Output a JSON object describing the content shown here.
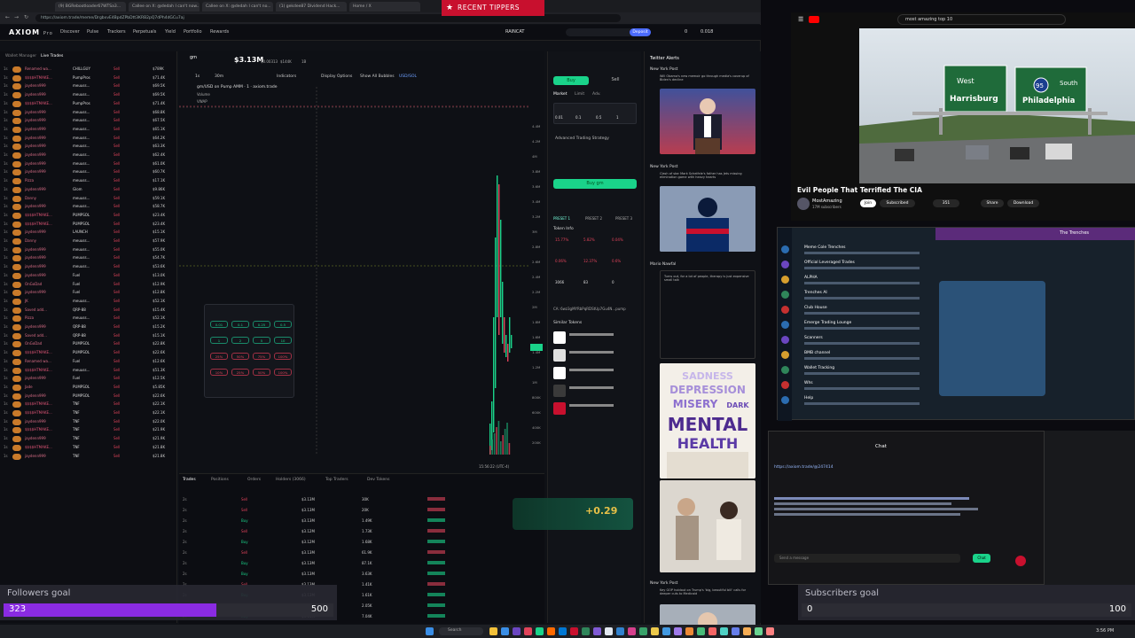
{
  "browser": {
    "tabs": [
      "(9) BGRebootloader67WTSa3...",
      "Callee on X: @dedah I can't now...",
      "Callee on X: @dedah I can't no...",
      "(1) gekdee87 Dividend Hack...",
      "Home / X"
    ],
    "url": "https://axiom.trade/meme/DrgbxvE4BpdZPbDtt3KRB2pQ7dPh4dGCu7aj"
  },
  "app": {
    "logo": "AXIOM",
    "logo_suffix": "Pro",
    "nav": [
      "Discover",
      "Pulse",
      "Trackers",
      "Perpetuals",
      "Yield",
      "Portfolio",
      "Rewards"
    ],
    "network": "RAINCAT",
    "deposit": "Deposit",
    "sol_balance": "0",
    "wallet_val": "0.018"
  },
  "leftlist": {
    "tabs": [
      "Wallet Manager",
      "Live Trades"
    ],
    "rows": [
      {
        "name": "Renamed wa...",
        "token": "CHILLGUY",
        "amt": "$789K"
      },
      {
        "name": "$$$$HTMAKE...",
        "token": "PumpPros",
        "amt": "$71.4K"
      },
      {
        "name": "jaydenn999",
        "token": "meuuss...",
        "amt": "$69.5K"
      },
      {
        "name": "jaydenn999",
        "token": "meuuss...",
        "amt": "$69.5K"
      },
      {
        "name": "$$$$HTMAKE...",
        "token": "PumpPros",
        "amt": "$71.4K"
      },
      {
        "name": "jaydenn999",
        "token": "meuuss...",
        "amt": "$68.8K"
      },
      {
        "name": "jaydenn999",
        "token": "meuuss...",
        "amt": "$67.5K"
      },
      {
        "name": "jaydenn999",
        "token": "meuuss...",
        "amt": "$65.1K"
      },
      {
        "name": "jaydenn999",
        "token": "meuuss...",
        "amt": "$64.2K"
      },
      {
        "name": "jaydenn999",
        "token": "meuuss...",
        "amt": "$63.3K"
      },
      {
        "name": "jaydenn999",
        "token": "meuuss...",
        "amt": "$62.4K"
      },
      {
        "name": "jaydenn999",
        "token": "meuuss...",
        "amt": "$61.0K"
      },
      {
        "name": "jaydenn999",
        "token": "meuuss...",
        "amt": "$60.7K"
      },
      {
        "name": "Pizza",
        "token": "meuuss...",
        "amt": "$17.1K"
      },
      {
        "name": "jaydenn999",
        "token": "Glom",
        "amt": "$9.86K"
      },
      {
        "name": "Danny",
        "token": "meuuss...",
        "amt": "$59.1K"
      },
      {
        "name": "jaydenn999",
        "token": "meuuss...",
        "amt": "$58.7K"
      },
      {
        "name": "$$$$HTMAKE...",
        "token": "PUMPSOL",
        "amt": "$23.4K"
      },
      {
        "name": "$$$$HTMAKE...",
        "token": "PUMPSOL",
        "amt": "$23.4K"
      },
      {
        "name": "jaydenn999",
        "token": "LAUNCH",
        "amt": "$15.1K"
      },
      {
        "name": "Danny",
        "token": "meuuss...",
        "amt": "$57.9K"
      },
      {
        "name": "jaydenn999",
        "token": "meuuss...",
        "amt": "$55.0K"
      },
      {
        "name": "jaydenn999",
        "token": "meuuss...",
        "amt": "$54.7K"
      },
      {
        "name": "jaydenn999",
        "token": "meuuss...",
        "amt": "$53.6K"
      },
      {
        "name": "jaydenn999",
        "token": "Fuel",
        "amt": "$13.0K"
      },
      {
        "name": "OnGoDad",
        "token": "Fuel",
        "amt": "$12.9K"
      },
      {
        "name": "jaydenn999",
        "token": "Fuel",
        "amt": "$12.8K"
      },
      {
        "name": "JK",
        "token": "meuuss...",
        "amt": "$52.1K"
      },
      {
        "name": "Saved add...",
        "token": "QRP-88",
        "amt": "$15.4K"
      },
      {
        "name": "Pizza",
        "token": "meuuss...",
        "amt": "$52.1K"
      },
      {
        "name": "jaydenn999",
        "token": "QRP-88",
        "amt": "$15.2K"
      },
      {
        "name": "Saved add...",
        "token": "QRP-88",
        "amt": "$15.1K"
      },
      {
        "name": "OnGoDad",
        "token": "PUMPSOL",
        "amt": "$22.8K"
      },
      {
        "name": "$$$$HTMAKE...",
        "token": "PUMPSOL",
        "amt": "$22.6K"
      },
      {
        "name": "Renamed wa...",
        "token": "Fuel",
        "amt": "$12.6K"
      },
      {
        "name": "$$$$HTMAKE...",
        "token": "meuuss...",
        "amt": "$51.3K"
      },
      {
        "name": "jaydenn999",
        "token": "Fuel",
        "amt": "$12.5K"
      },
      {
        "name": "Jade",
        "token": "PUMPSOL",
        "amt": "$5.85K"
      },
      {
        "name": "jaydenn999",
        "token": "PUMPSOL",
        "amt": "$22.6K"
      },
      {
        "name": "$$$$HTMAKE...",
        "token": "TNF",
        "amt": "$22.1K"
      },
      {
        "name": "$$$$HTMAKE...",
        "token": "TNF",
        "amt": "$22.1K"
      },
      {
        "name": "jaydenn999",
        "token": "TNF",
        "amt": "$22.0K"
      },
      {
        "name": "$$$$HTMAKE...",
        "token": "TNF",
        "amt": "$21.9K"
      },
      {
        "name": "jaydenn999",
        "token": "TNF",
        "amt": "$21.9K"
      },
      {
        "name": "$$$$HTMAKE...",
        "token": "TNF",
        "amt": "$21.8K"
      },
      {
        "name": "jaydenn999",
        "token": "TNF",
        "amt": "$21.8K"
      }
    ]
  },
  "chart": {
    "mcap": "$3.13M",
    "price": "$0.00313",
    "liquidity": "$144K",
    "supply": "1B",
    "timeframe": "1s",
    "interval_label": "30m",
    "indicators": "Indicators",
    "display": "Display Options",
    "bubbles": "Show All Bubbles",
    "currency": "USD/SOL",
    "pair": "gm/USD on Pump AMM · 1 · axiom.trade",
    "volume_label": "Volume",
    "vwap_label": "VWAP",
    "clock": "15:56:22 (UTC-4)",
    "price_ticks": [
      "4.4M",
      "4.2M",
      "4M",
      "3.8M",
      "3.6M",
      "3.4M",
      "3.2M",
      "3M",
      "2.8M",
      "2.6M",
      "2.4M",
      "2.2M",
      "2M",
      "1.8M",
      "1.6M",
      "1.4M",
      "1.2M",
      "1M",
      "800K",
      "600K",
      "400K",
      "200K"
    ]
  },
  "trades": {
    "tabs": [
      "Trades",
      "Positions",
      "Orders",
      "Holders (3066)",
      "Top Traders",
      "Dev Tokens"
    ],
    "sides": [
      "Sell",
      "Sell",
      "Buy",
      "Sell",
      "Buy",
      "Sell",
      "Buy",
      "Buy",
      "Sell",
      "Buy",
      "Buy",
      "Buy",
      "Buy"
    ],
    "mcs": [
      "$3.13M",
      "$3.13M",
      "$3.13M",
      "$3.12M",
      "$3.12M",
      "$3.13M",
      "$3.13M",
      "$3.13M",
      "$3.13M",
      "$3.13M",
      "$3.14M",
      "$3.13M",
      "$3.13M"
    ],
    "amounts": [
      "30K",
      "20K",
      "1.49K",
      "1.73K",
      "1.68K",
      "61.9K",
      "87.1K",
      "3.63K",
      "1.41K",
      "1.61K",
      "2.05K",
      "7.04K",
      "7.18K"
    ]
  },
  "order": {
    "tabs": [
      "Buy",
      "Sell"
    ],
    "modes": [
      "Market",
      "Limit",
      "Adv."
    ],
    "amounts": [
      "0.01",
      "0.1",
      "0.5",
      "1"
    ],
    "advanced": "Advanced Trading Strategy",
    "buy_button": "Buy gm",
    "presets": [
      "PRESET 1",
      "PRESET 2",
      "PRESET 3"
    ],
    "token_info": "Token Info",
    "similar_tokens": "Similar Tokens",
    "ca": "CA: 6wz3gMYRbPqRDStUp7Gu4N...pump"
  },
  "tracker": {
    "title": "Twitter Alerts",
    "tweets": [
      {
        "author": "New York Post",
        "text": "Will Obama's new memoir go through media's coverup of Biden's decline"
      },
      {
        "author": "New York Post",
        "text": "Clash of star Mark Scheifele's father has Jets missing elimination game with heavy hearts"
      },
      {
        "author": "Mario Nawfal",
        "text": "Turns out, for a lot of people, therapy is just expensive small talk"
      },
      {
        "author": "New York Post",
        "text": "Key GOP holdout on Trump's 'big, beautiful bill' calls for deeper cuts to Medicaid"
      }
    ],
    "meme_lines": [
      "SADNESS",
      "DEPRESSION",
      "MISERY",
      "DARK",
      "MENTAL",
      "HEALTH"
    ]
  },
  "overlay": {
    "recent_tippers": "RECENT TIPPERS",
    "donation_amount": "+0.29"
  },
  "youtube": {
    "search": "most amazing top 10",
    "title": "Evil People That Terrified The CIA",
    "channel": "MostAmazing",
    "subscribers": "17M subscribers",
    "likes": "351",
    "share": "Share",
    "download": "Download",
    "join": "Join",
    "subscribed": "Subscribed",
    "sign_harrisburg": "Harrisburg",
    "sign_philadelphia": "Philadelphia",
    "sign_south": "South",
    "sign_route": "95",
    "sign_west": "West"
  },
  "telegram": {
    "title": "The Trenches",
    "chats": [
      "Meme Cole Trenches",
      "Official Leveraged Trades",
      "ALPHA",
      "Trenches AI",
      "Club House",
      "Emerge Trading Lounge",
      "Scanners",
      "BMB channel",
      "Wallet Tracking",
      "Whs",
      "Help"
    ]
  },
  "chat": {
    "title": "Chat",
    "placeholder": "Send a message",
    "chat_button": "Chat",
    "link": "https://axiom.trade/@247414"
  },
  "goals": {
    "followers_label": "Followers goal",
    "followers_current": 323,
    "followers_target": 500,
    "subs_label": "Subscribers goal",
    "subs_current": 0,
    "subs_target": 100
  },
  "taskbar": {
    "search": "Search",
    "time": "3:56 PM"
  },
  "colors": {
    "accent_green": "#1ad38a",
    "sell_red": "#e0435a",
    "purple": "#8a2be2",
    "tippers_red": "#c8102e"
  }
}
